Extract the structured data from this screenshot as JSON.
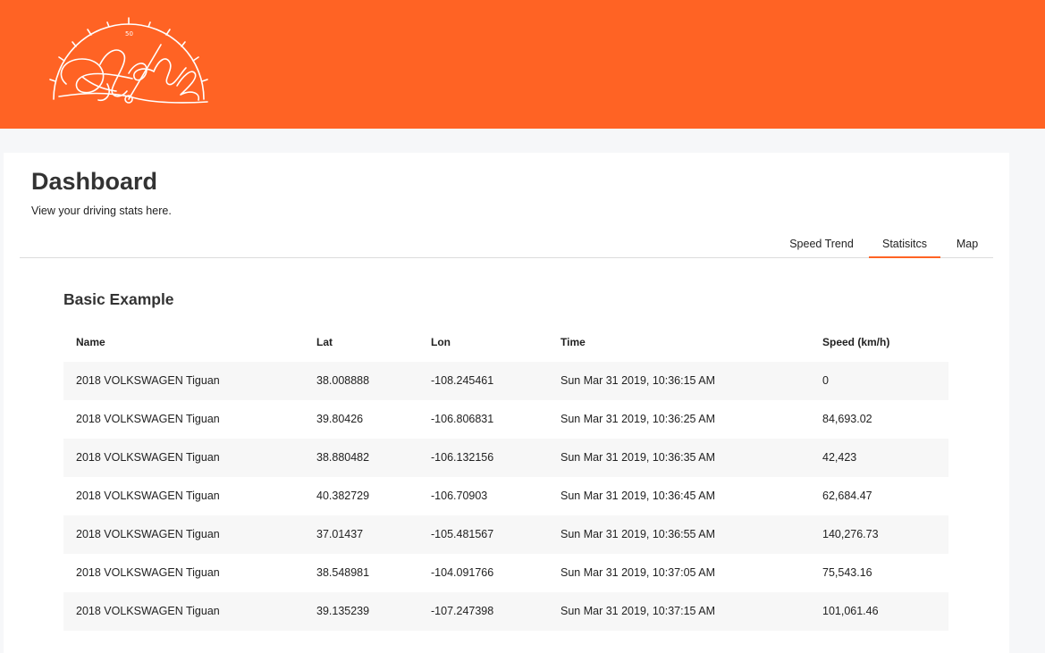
{
  "header": {
    "logo_icon": "speedometer-signature-logo-icon",
    "logo_speed_mark": "50",
    "brand_color": "#ff6324"
  },
  "dashboard": {
    "title": "Dashboard",
    "subtitle": "View your driving stats here."
  },
  "tabs": [
    {
      "label": "Speed Trend",
      "active": false
    },
    {
      "label": "Statisitcs",
      "active": true
    },
    {
      "label": "Map",
      "active": false
    }
  ],
  "table": {
    "title": "Basic Example",
    "columns": [
      "Name",
      "Lat",
      "Lon",
      "Time",
      "Speed (km/h)"
    ],
    "rows": [
      [
        "2018 VOLKSWAGEN Tiguan",
        "38.008888",
        "-108.245461",
        "Sun Mar 31 2019, 10:36:15 AM",
        "0"
      ],
      [
        "2018 VOLKSWAGEN Tiguan",
        "39.80426",
        "-106.806831",
        "Sun Mar 31 2019, 10:36:25 AM",
        "84,693.02"
      ],
      [
        "2018 VOLKSWAGEN Tiguan",
        "38.880482",
        "-106.132156",
        "Sun Mar 31 2019, 10:36:35 AM",
        "42,423"
      ],
      [
        "2018 VOLKSWAGEN Tiguan",
        "40.382729",
        "-106.70903",
        "Sun Mar 31 2019, 10:36:45 AM",
        "62,684.47"
      ],
      [
        "2018 VOLKSWAGEN Tiguan",
        "37.01437",
        "-105.481567",
        "Sun Mar 31 2019, 10:36:55 AM",
        "140,276.73"
      ],
      [
        "2018 VOLKSWAGEN Tiguan",
        "38.548981",
        "-104.091766",
        "Sun Mar 31 2019, 10:37:05 AM",
        "75,543.16"
      ],
      [
        "2018 VOLKSWAGEN Tiguan",
        "39.135239",
        "-107.247398",
        "Sun Mar 31 2019, 10:37:15 AM",
        "101,061.46"
      ]
    ]
  }
}
